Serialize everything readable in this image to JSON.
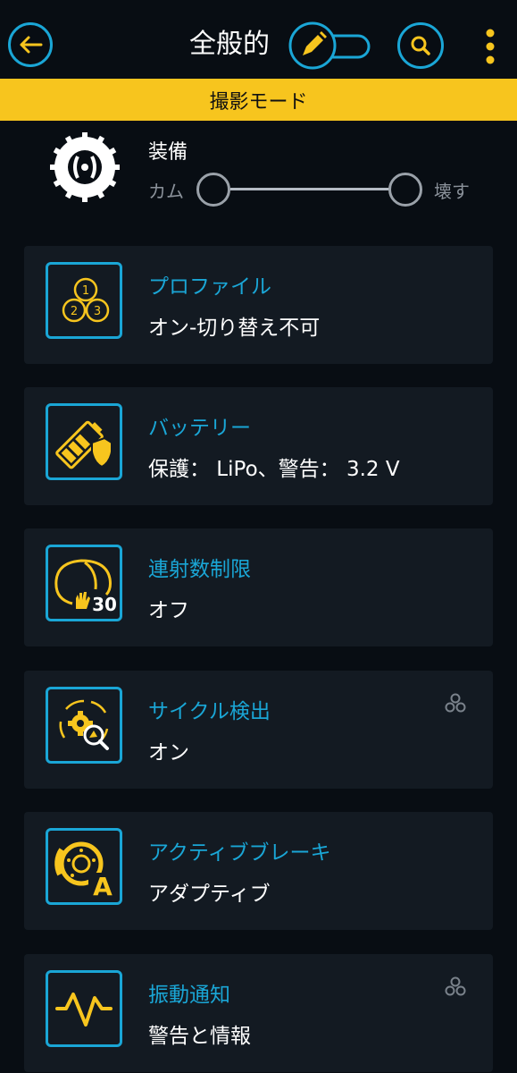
{
  "header": {
    "title": "全般的"
  },
  "mode_bar": {
    "label": "撮影モード"
  },
  "equipment": {
    "label": "装備",
    "slider_left": "カム",
    "slider_right": "壊す"
  },
  "settings": [
    {
      "title": "プロファイル",
      "value": "オン-切り替え不可",
      "icon": "profiles-icon"
    },
    {
      "title": "バッテリー",
      "value": "保護： LiPo、警告： 3.2 V",
      "icon": "battery-shield-icon"
    },
    {
      "title": "連射数制限",
      "value": "オフ",
      "icon": "burst-limit-icon",
      "icon_text": "30"
    },
    {
      "title": "サイクル検出",
      "value": "オン",
      "icon": "cycle-detection-icon",
      "badge": "profiles-badge-icon"
    },
    {
      "title": "アクティブブレーキ",
      "value": "アダプティブ",
      "icon": "active-brake-icon",
      "icon_text": "A"
    },
    {
      "title": "振動通知",
      "value": "警告と情報",
      "icon": "vibration-icon",
      "badge": "profiles-badge-icon"
    }
  ],
  "colors": {
    "accent": "#1aa6d6",
    "highlight": "#f7c51e",
    "background": "#080d13",
    "card": "#131a22"
  }
}
